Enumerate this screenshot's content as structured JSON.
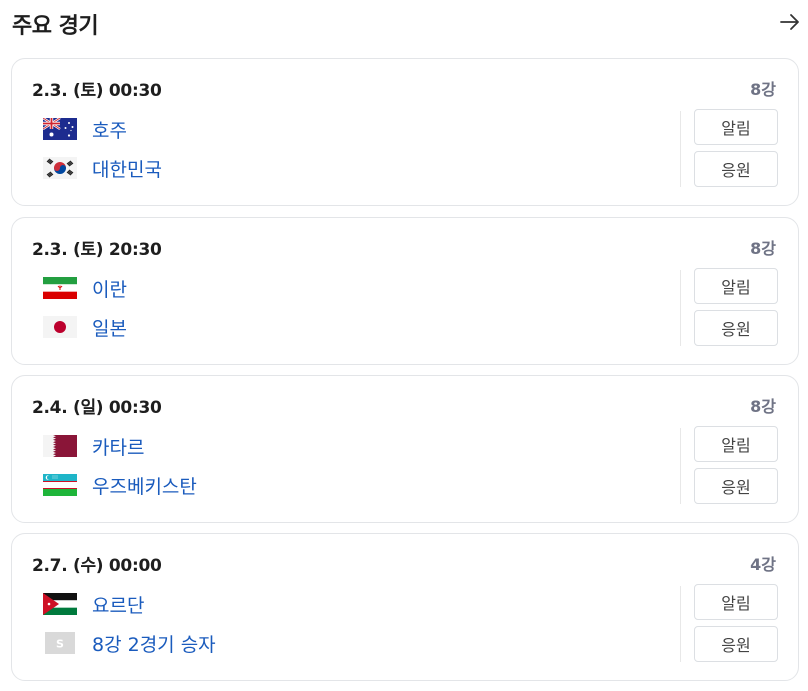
{
  "header": {
    "title": "주요 경기",
    "arrow_icon": "arrow-right-icon"
  },
  "matches": [
    {
      "time": "2.3. (토) 00:30",
      "round": "8강",
      "teams": [
        {
          "name": "호주",
          "flag": "australia-flag-icon"
        },
        {
          "name": "대한민국",
          "flag": "south-korea-flag-icon"
        }
      ],
      "alarm_label": "알림",
      "cheer_label": "응원"
    },
    {
      "time": "2.3. (토) 20:30",
      "round": "8강",
      "teams": [
        {
          "name": "이란",
          "flag": "iran-flag-icon"
        },
        {
          "name": "일본",
          "flag": "japan-flag-icon"
        }
      ],
      "alarm_label": "알림",
      "cheer_label": "응원"
    },
    {
      "time": "2.4. (일) 00:30",
      "round": "8강",
      "teams": [
        {
          "name": "카타르",
          "flag": "qatar-flag-icon"
        },
        {
          "name": "우즈베키스탄",
          "flag": "uzbekistan-flag-icon"
        }
      ],
      "alarm_label": "알림",
      "cheer_label": "응원"
    },
    {
      "time": "2.7. (수) 00:00",
      "round": "4강",
      "teams": [
        {
          "name": "요르단",
          "flag": "jordan-flag-icon"
        },
        {
          "name": "8강 2경기 승자",
          "flag": "placeholder-team-icon",
          "placeholder_letter": "S"
        }
      ],
      "alarm_label": "알림",
      "cheer_label": "응원"
    }
  ]
}
